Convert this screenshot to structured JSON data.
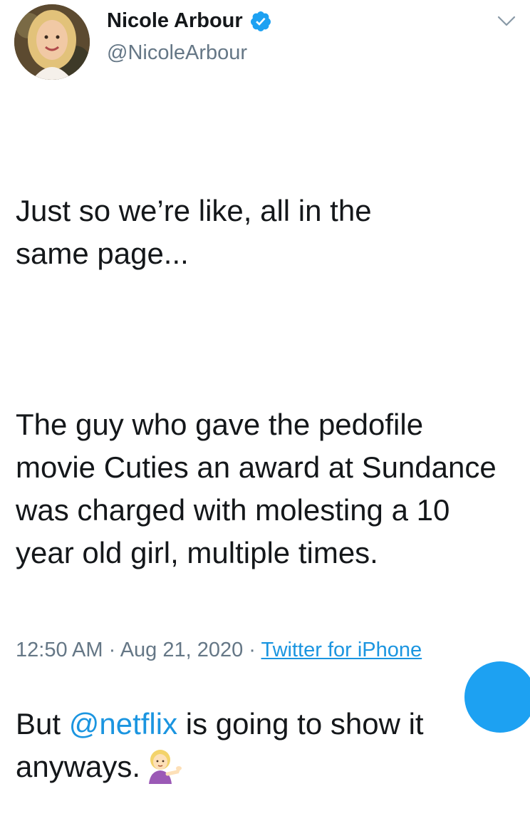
{
  "author": {
    "display_name": "Nicole Arbour",
    "handle": "@NicoleArbour",
    "verified": true,
    "avatar_icon": "profile-photo"
  },
  "tweet": {
    "line1_part1": "Just so we’re like, all in the",
    "line1_part2": "same page...",
    "para2": "The guy who gave the pedofile movie Cuties an award at Sundance was charged with molesting a 10 year old girl, multiple times.",
    "para3_before": "But ",
    "para3_mention": "@netflix",
    "para3_after": " is going to show it anyways.",
    "emoji": "woman-tipping-hand"
  },
  "meta": {
    "time": "12:50 AM",
    "separator1": " · ",
    "date": "Aug 21, 2020",
    "separator2": " · ",
    "source": "Twitter for iPhone"
  },
  "colors": {
    "link": "#1b95e0",
    "muted": "#657786",
    "text": "#14171a",
    "fab": "#1da1f2"
  }
}
